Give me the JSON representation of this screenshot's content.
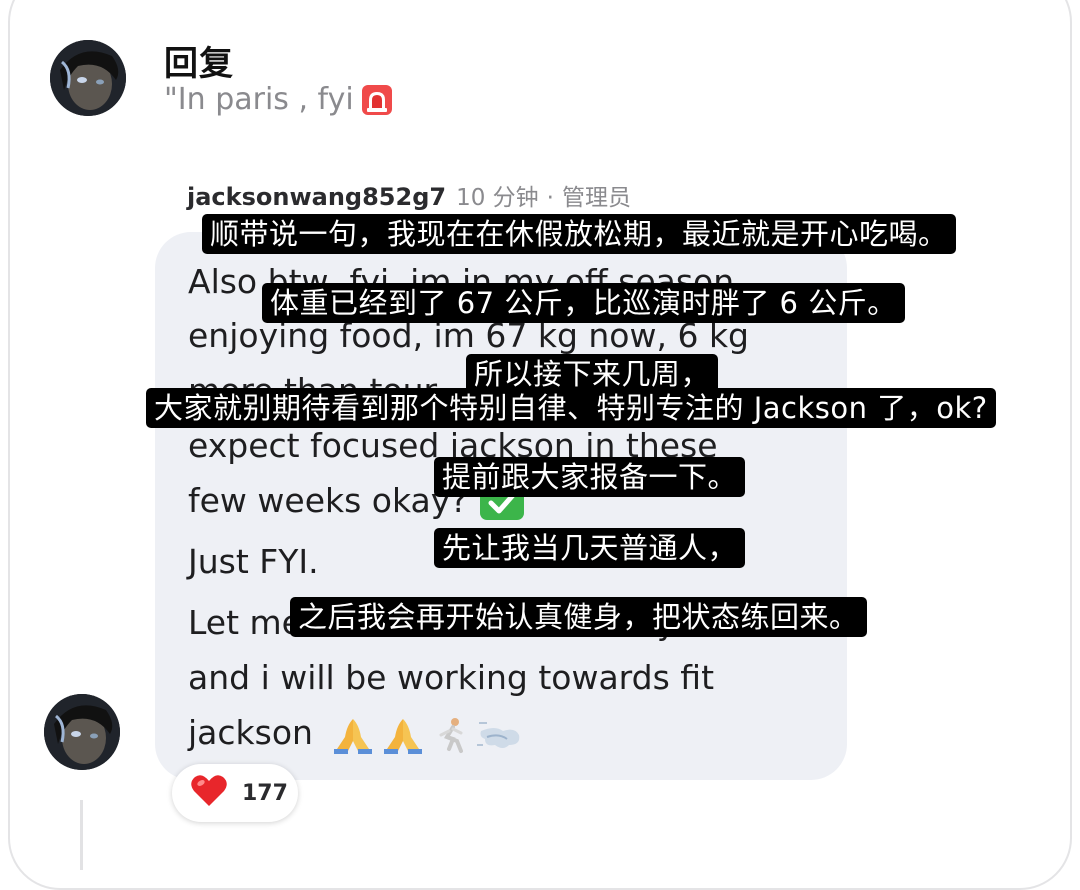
{
  "header": {
    "title": "回复",
    "quoted_text": "\"In paris , fyi"
  },
  "comment": {
    "username": "jacksonwang852g7",
    "time": "10 分钟",
    "separator": "·",
    "role": "管理员",
    "lines": [
      "Also btw, fyi, im in my off season,",
      "enjoying food, im 67 kg now, 6 kg",
      "more than tour , so please dont",
      "expect focused jackson in these",
      "few weeks okay?",
      "Just FYI.",
      "Let me be normal for few days",
      "and i will be working towards fit",
      "jackson"
    ]
  },
  "subtitles": [
    "顺带说一句，我现在在休假放松期，最近就是开心吃喝。",
    "体重已经到了 67 公斤，比巡演时胖了 6 公斤。",
    "所以接下来几周，",
    "大家就别期待看到那个特别自律、特别专注的 Jackson 了，ok?",
    "提前跟大家报备一下。",
    "先让我当几天普通人，",
    "之后我会再开始认真健身，把状态练回来。"
  ],
  "reaction": {
    "icon": "heart-icon",
    "count": "177",
    "color": "#e8262b"
  },
  "colors": {
    "bubble": "#eef0f5",
    "subtitle_bg": "#000000",
    "meta_gray": "#8a8a8e"
  }
}
